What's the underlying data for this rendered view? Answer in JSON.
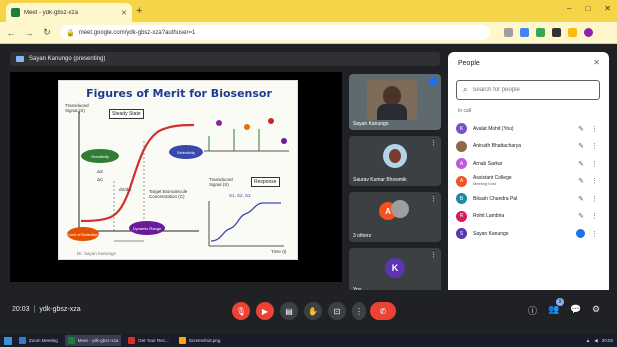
{
  "browser": {
    "tab_title": "Meet - ydk-gbsz-xza",
    "new_tab": "+",
    "url": "meet.google.com/ydk-gbsz-xza?authuser=1",
    "window_controls": [
      "–",
      "□",
      "✕"
    ]
  },
  "meet": {
    "presenter_label": "Sayan Kanungo (presenting)",
    "slide": {
      "title": "Figures of Merit for Biosensor",
      "labels": {
        "transduced": "Transduced Signal (S)",
        "steady": "Steady State",
        "sensitivity": "Sensitivity",
        "selectivity": "Selectivity",
        "lod": "Limit of Detection",
        "dynamic": "Dynamic Range",
        "target": "Target Biomolecule Concentration (C)",
        "transduced2": "Transduced Signal (S)",
        "time": "Time (t)",
        "response": "Response",
        "credit": "Dr. Sayan Kanungo",
        "formula": "S1, S2, S3",
        "ds": "ΔS",
        "dc": "ΔC",
        "dsdc": "dS/dC"
      }
    },
    "tiles": [
      {
        "name": "Sayan Kanungo",
        "type": "video"
      },
      {
        "name": "Saurav Kumar Bhowmik",
        "type": "photo"
      },
      {
        "name": "3 others",
        "type": "group",
        "initial": "A"
      },
      {
        "name": "You",
        "type": "avatar",
        "initial": "K"
      }
    ]
  },
  "people": {
    "title": "People",
    "search_placeholder": "Search for people",
    "section": "In call",
    "participants": [
      {
        "initial": "K",
        "color": "#7b4fc9",
        "name": "Avalat Mohit (You)",
        "sub": "",
        "mic_active": false
      },
      {
        "initial": "",
        "color": "#8a6a4a",
        "name": "Anirudh Bhattacharya",
        "sub": "",
        "mic_active": false
      },
      {
        "initial": "A",
        "color": "#c158dc",
        "name": "Arnab Sarkar",
        "sub": "",
        "mic_active": false
      },
      {
        "initial": "A",
        "color": "#f4511e",
        "name": "Assistant College",
        "sub": "Meeting host",
        "mic_active": false
      },
      {
        "initial": "B",
        "color": "#1e88a5",
        "name": "Bikash Chandra Pal",
        "sub": "",
        "mic_active": false
      },
      {
        "initial": "R",
        "color": "#d81b60",
        "name": "Rohit Lambria",
        "sub": "",
        "mic_active": false
      },
      {
        "initial": "S",
        "color": "#5e35b1",
        "name": "Sayan Kanungo",
        "sub": "",
        "mic_active": true
      }
    ]
  },
  "controls": {
    "time": "20:03",
    "meeting_code": "ydk-gbsz-xza",
    "participant_count": "9"
  },
  "taskbar": {
    "items": [
      "Meet - ydk-gbsz-xza",
      "Zoom Meeting",
      "Get Your Rec...",
      "Screenshot.png"
    ],
    "tray_time": "20:03"
  },
  "colors": {
    "accent": "#1a73e8",
    "danger": "#ea4335",
    "tabbar": "#f5d547"
  }
}
